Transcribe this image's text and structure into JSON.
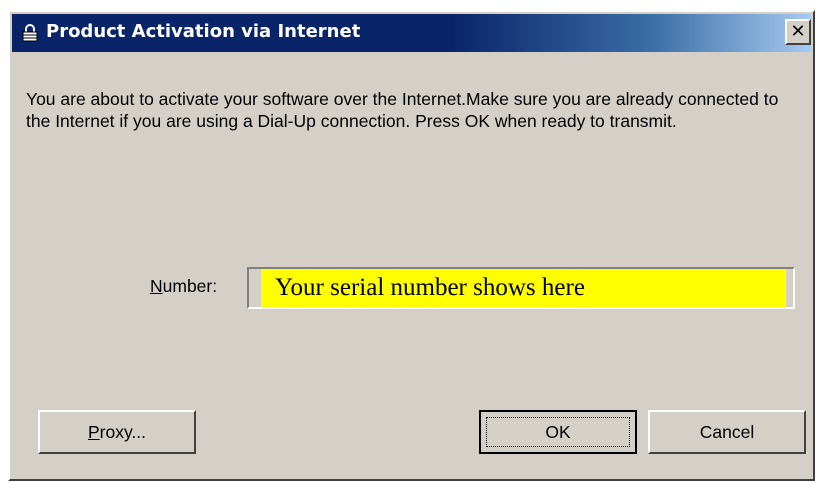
{
  "window": {
    "title": "Product Activation via Internet",
    "close_label": "✕"
  },
  "message": "You are about to activate your software over the Internet.Make sure you are already connected to the Internet if you are using a Dial-Up connection.  Press OK when ready to transmit.",
  "number": {
    "label_first": "N",
    "label_rest": "umber:",
    "value": "Your serial number shows here",
    "highlight_color": "#ffff00"
  },
  "buttons": {
    "proxy_first": "P",
    "proxy_rest": "roxy...",
    "ok_label": "OK",
    "cancel_label": "Cancel"
  }
}
